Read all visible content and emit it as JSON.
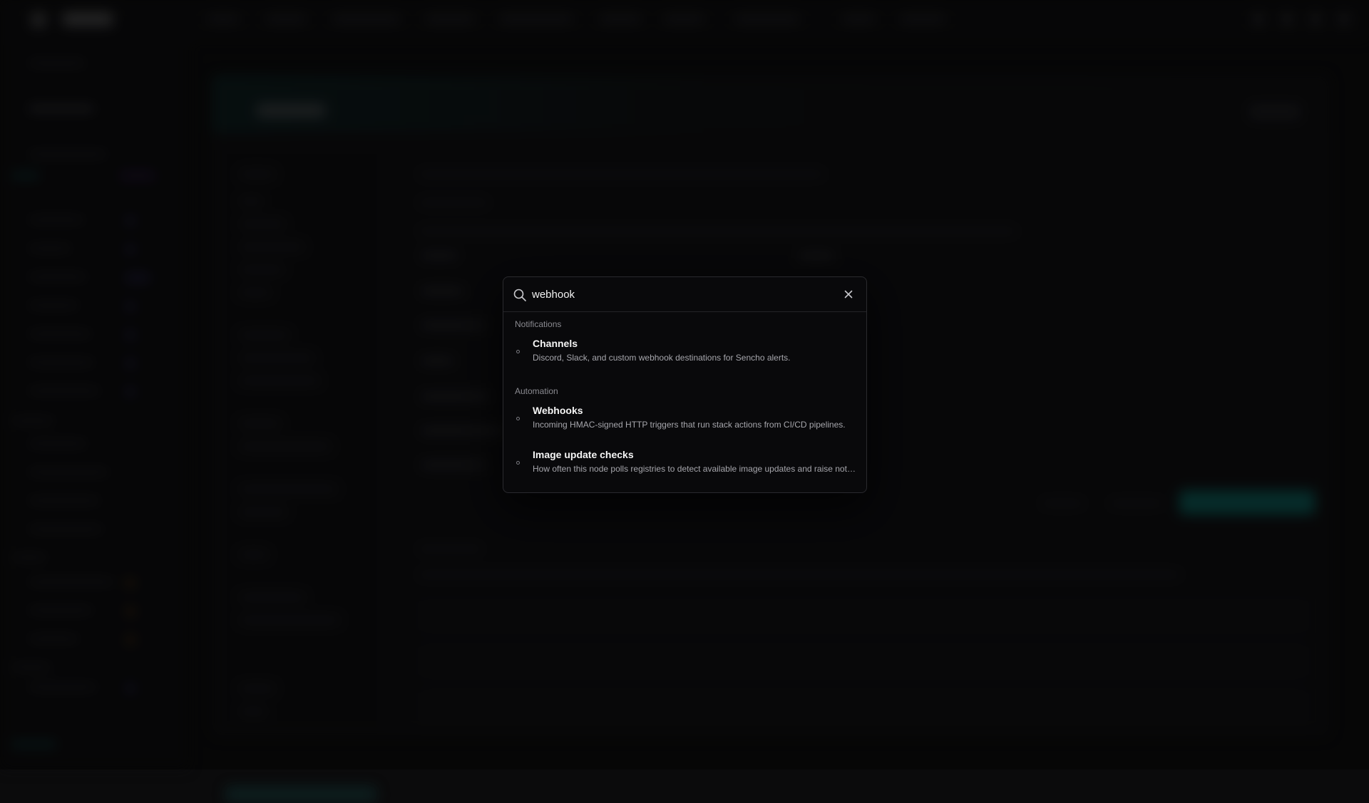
{
  "search": {
    "value": "webhook",
    "icon": "search-icon",
    "close_icon": "close-icon"
  },
  "groups": [
    {
      "label": "Notifications",
      "items": [
        {
          "title": "Channels",
          "description": "Discord, Slack, and custom webhook destinations for Sencho alerts."
        }
      ]
    },
    {
      "label": "Automation",
      "items": [
        {
          "title": "Webhooks",
          "description": "Incoming HMAC-signed HTTP triggers that run stack actions from CI/CD pipelines."
        },
        {
          "title": "Image update checks",
          "description": "How often this node polls registries to detect available image updates and raise notifications."
        }
      ]
    }
  ],
  "colors": {
    "accent": "#0e8a82",
    "palette_bg": "#09090b",
    "text_primary": "#f5f5f5",
    "text_muted": "#a6a6ac"
  }
}
